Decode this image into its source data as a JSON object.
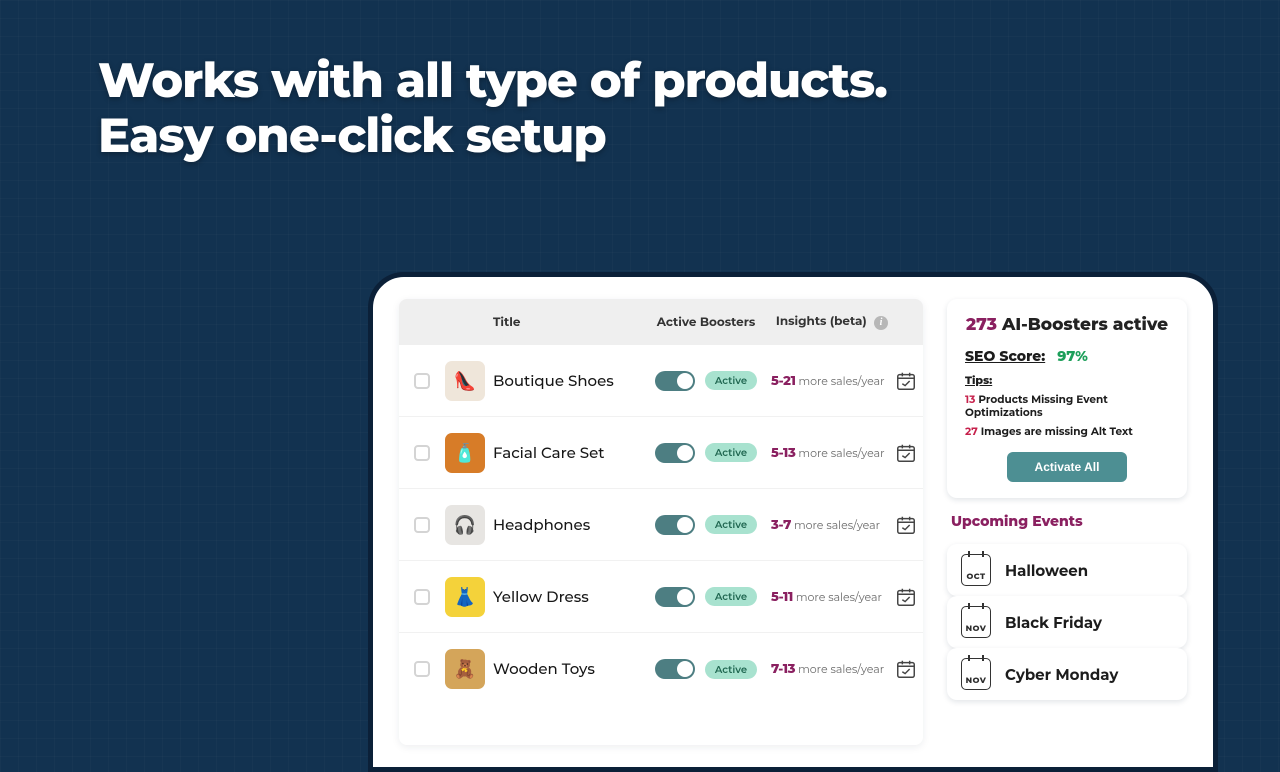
{
  "hero": {
    "line1": "Works with all type of products.",
    "line2": "Easy one-click setup"
  },
  "table": {
    "headers": {
      "title": "Title",
      "boosters": "Active Boosters",
      "insights": "Insights (beta)"
    },
    "active_pill": "Active",
    "insights_suffix": "more sales/year",
    "rows": [
      {
        "title": "Boutique Shoes",
        "range": "5-21",
        "thumb_bg": "#efe6da",
        "thumb_glyph": "👠"
      },
      {
        "title": "Facial Care Set",
        "range": "5-13",
        "thumb_bg": "#d77c28",
        "thumb_glyph": "🧴"
      },
      {
        "title": "Headphones",
        "range": "3-7",
        "thumb_bg": "#e7e5e2",
        "thumb_glyph": "🎧"
      },
      {
        "title": "Yellow Dress",
        "range": "5-11",
        "thumb_bg": "#f4d23a",
        "thumb_glyph": "👗"
      },
      {
        "title": "Wooden Toys",
        "range": "7-13",
        "thumb_bg": "#d4a55a",
        "thumb_glyph": "🧸"
      }
    ]
  },
  "stats": {
    "count": "273",
    "count_label": "AI-Boosters active",
    "seo_label": "SEO Score:",
    "seo_pct": "97%",
    "tips_label": "Tips:",
    "tip1_num": "13",
    "tip1_text": "Products Missing Event Optimizations",
    "tip2_num": "27",
    "tip2_text": "Images are missing Alt Text",
    "activate_btn": "Activate All"
  },
  "events": {
    "heading": "Upcoming Events",
    "items": [
      {
        "month": "OCT",
        "name": "Halloween"
      },
      {
        "month": "NOV",
        "name": "Black Friday"
      },
      {
        "month": "NOV",
        "name": "Cyber Monday"
      }
    ]
  }
}
